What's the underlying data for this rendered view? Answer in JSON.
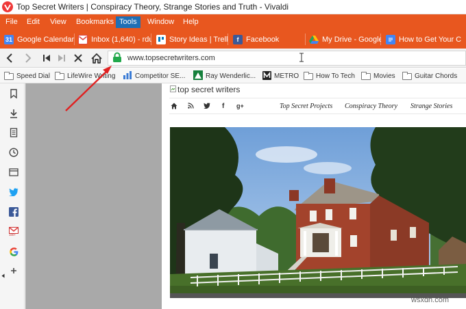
{
  "window": {
    "title": "Top Secret Writers | Conspiracy Theory, Strange Stories and Truth - Vivaldi"
  },
  "menu": {
    "items": [
      {
        "label": "File"
      },
      {
        "label": "Edit"
      },
      {
        "label": "View"
      },
      {
        "label": "Bookmarks"
      },
      {
        "label": "Tools",
        "active": true
      },
      {
        "label": "Window"
      },
      {
        "label": "Help"
      }
    ]
  },
  "tabs": [
    {
      "label": "Google Calendar -",
      "icon": "calendar-icon",
      "color": "#4285f4"
    },
    {
      "label": "Inbox (1,640) - rdu",
      "icon": "gmail-icon",
      "color": "#ffffff"
    },
    {
      "label": "Story Ideas | Trello",
      "icon": "trello-icon",
      "color": "#0079bf"
    },
    {
      "label": "Facebook",
      "icon": "facebook-icon",
      "color": "#3b5998"
    },
    {
      "label": "My Drive - Google",
      "icon": "drive-icon",
      "color": "#1fa463"
    },
    {
      "label": "How to Get Your C",
      "icon": "docs-icon",
      "color": "#4285f4"
    }
  ],
  "address": {
    "url": "www.topsecretwriters.com"
  },
  "bookmarks": [
    {
      "label": "Speed Dial",
      "icon": "folder-icon"
    },
    {
      "label": "LifeWire Writing",
      "icon": "folder-icon"
    },
    {
      "label": "Competitor SE...",
      "icon": "chart-icon"
    },
    {
      "label": "Ray Wenderlic...",
      "icon": "raywenderlich-icon"
    },
    {
      "label": "METRO",
      "icon": "metro-icon"
    },
    {
      "label": "How To Tech",
      "icon": "folder-icon"
    },
    {
      "label": "Movies",
      "icon": "folder-icon"
    },
    {
      "label": "Guitar Chords",
      "icon": "folder-icon"
    }
  ],
  "page": {
    "logo_alt": "top secret writers",
    "nav_links": [
      {
        "label": "Top Secret Projects"
      },
      {
        "label": "Conspiracy Theory"
      },
      {
        "label": "Strange Stories"
      }
    ]
  },
  "watermark": "wsxdn.com",
  "colors": {
    "accent": "#e8571f",
    "active_menu": "#1f6fb5",
    "arrow": "#e02020"
  }
}
